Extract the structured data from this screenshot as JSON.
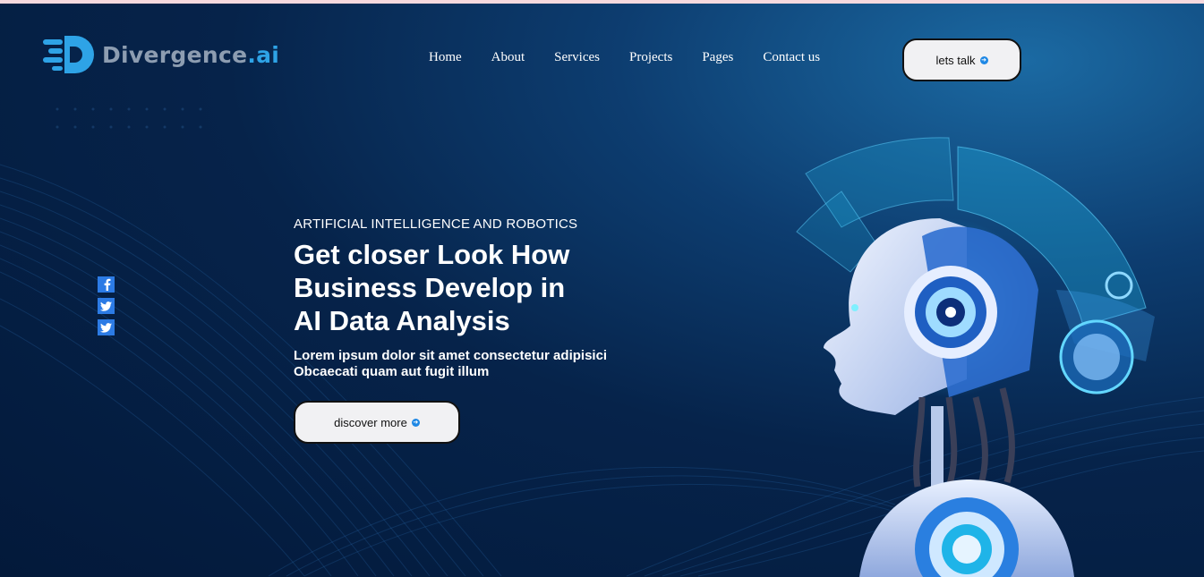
{
  "brand": {
    "name": "Divergence",
    "suffix": ".ai"
  },
  "nav": {
    "items": [
      {
        "label": "Home"
      },
      {
        "label": "About"
      },
      {
        "label": "Services"
      },
      {
        "label": "Projects"
      },
      {
        "label": "Pages"
      },
      {
        "label": "Contact us"
      }
    ]
  },
  "header_cta": {
    "label": "lets talk",
    "icon": "arrow-right-circle-icon"
  },
  "hero": {
    "eyebrow": "ARTIFICIAL INTELLIGENCE AND ROBOTICS",
    "headline_lines": [
      "Get closer Look How",
      "Business Develop in",
      "AI Data Analysis"
    ],
    "description_lines": [
      "Lorem ipsum dolor sit amet consectetur adipisici",
      "Obcaecati quam aut fugit illum"
    ],
    "cta": {
      "label": "discover more",
      "icon": "arrow-right-circle-icon"
    }
  },
  "social": [
    "facebook-icon",
    "twitter-icon",
    "twitter-icon"
  ],
  "colors": {
    "background": "#03193a",
    "accent": "#2ea3e6",
    "logo_gray": "#8d9db1",
    "button_bg": "#f1f1f3",
    "social_blue": "#2c7be5"
  }
}
